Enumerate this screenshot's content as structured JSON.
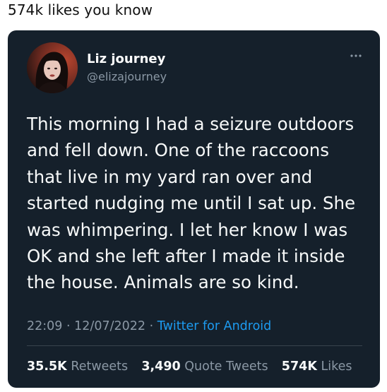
{
  "caption": "574k likes you know",
  "tweet": {
    "author_name": "Liz journey",
    "author_handle": "@elizajourney",
    "text": "This morning I had a seizure outdoors and fell down. One of the raccoons that live in my yard ran over and started nudging me until I sat up. She was whimpering. I let her know I was OK and she left after I made it inside the house. Animals are so kind.",
    "time": "22:09",
    "separator": "·",
    "date": "12/07/2022",
    "source": "Twitter for Android",
    "stats": {
      "retweets_count": "35.5K",
      "retweets_label": "Retweets",
      "quotes_count": "3,490",
      "quotes_label": "Quote Tweets",
      "likes_count": "574K",
      "likes_label": "Likes"
    }
  },
  "icons": {
    "more": "more-options-icon",
    "avatar": "profile-avatar"
  },
  "colors": {
    "card_bg": "#15202b",
    "text_primary": "#f7f9f9",
    "text_secondary": "#8b98a5",
    "link": "#1d9bf0",
    "divider": "#38444d"
  }
}
